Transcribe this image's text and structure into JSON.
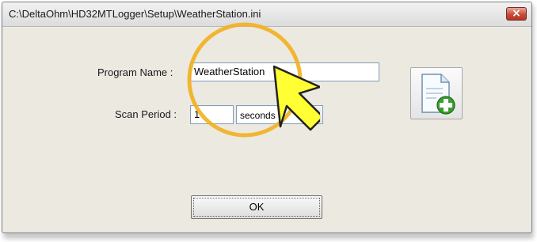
{
  "window": {
    "title": "C:\\DeltaOhm\\HD32MTLogger\\Setup\\WeatherStation.ini",
    "close_label": "×"
  },
  "form": {
    "program_name_label": "Program Name :",
    "program_name_value": "WeatherStation",
    "scan_period_label": "Scan Period :",
    "scan_period_value": "1",
    "scan_period_unit": "seconds"
  },
  "buttons": {
    "ok_label": "OK",
    "new_file_icon": "new-file-add-icon"
  },
  "overlay": {
    "callout_circle_color": "#f2b01e",
    "pointer_arrow_color": "#ffff33"
  }
}
